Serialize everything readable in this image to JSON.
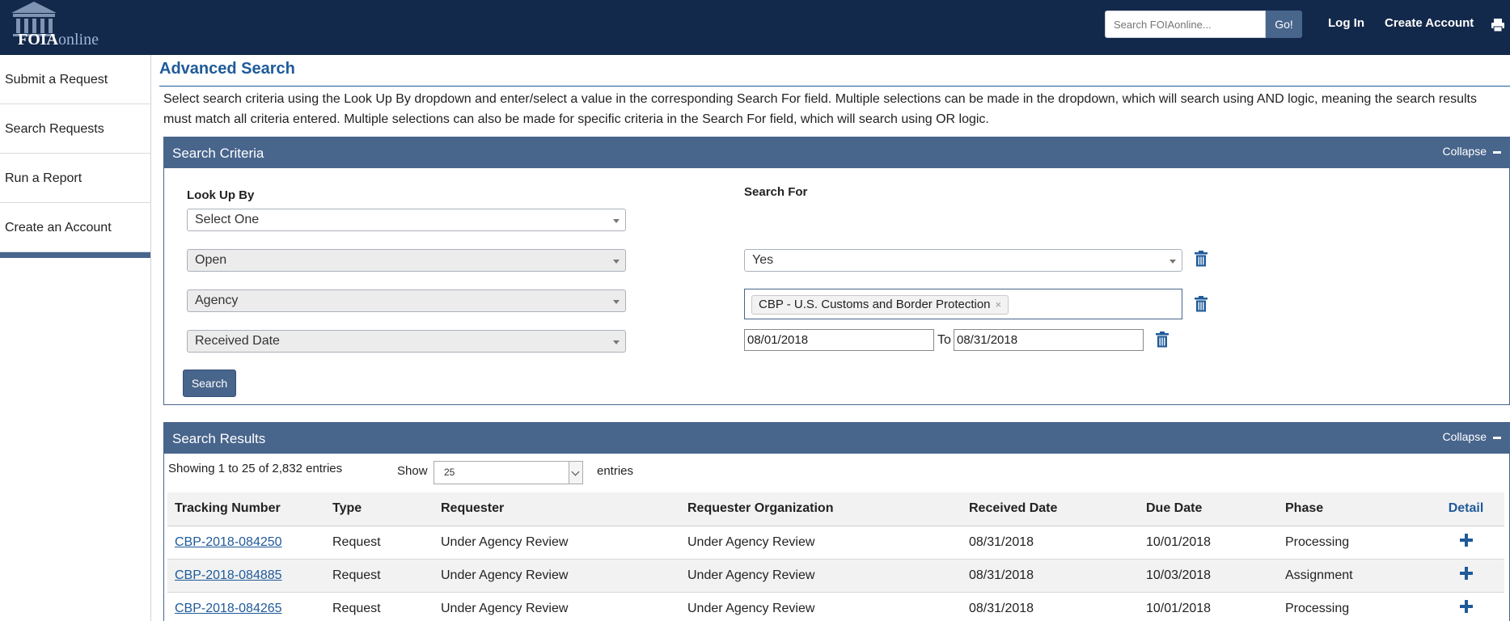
{
  "header": {
    "logo_bold": "FOIA",
    "logo_light": "online",
    "search_placeholder": "Search FOIAonline...",
    "go_label": "Go!",
    "login_label": "Log In",
    "create_account_label": "Create Account"
  },
  "sidebar": {
    "items": [
      {
        "label": "Submit a Request"
      },
      {
        "label": "Search Requests"
      },
      {
        "label": "Run a Report"
      },
      {
        "label": "Create an Account"
      }
    ]
  },
  "page": {
    "title": "Advanced Search",
    "intro": "Select search criteria using the Look Up By dropdown and enter/select a value in the corresponding Search For field. Multiple selections can be made in the dropdown, which will search using AND logic, meaning the search results must match all criteria entered. Multiple selections can also be made for specific criteria in the Search For field, which will search using OR logic."
  },
  "criteria": {
    "title": "Search Criteria",
    "collapse_label": "Collapse",
    "lookup_label": "Look Up By",
    "searchfor_label": "Search For",
    "select_one": "Select One",
    "rows": [
      {
        "lookup": "Open",
        "value": "Yes"
      },
      {
        "lookup": "Agency",
        "tag": "CBP - U.S. Customs and Border Protection",
        "tag_remove": "×"
      },
      {
        "lookup": "Received Date",
        "date_from": "08/01/2018",
        "to_label": "To",
        "date_to": "08/31/2018"
      }
    ],
    "search_button": "Search"
  },
  "results": {
    "title": "Search Results",
    "collapse_label": "Collapse",
    "showing": "Showing 1 to 25 of 2,832 entries",
    "show_label": "Show",
    "page_size": "25",
    "entries_label": "entries",
    "columns": [
      "Tracking Number",
      "Type",
      "Requester",
      "Requester Organization",
      "Received Date",
      "Due Date",
      "Phase",
      "Detail"
    ],
    "rows": [
      {
        "tracking": "CBP-2018-084250",
        "type": "Request",
        "requester": "Under Agency Review",
        "org": "Under Agency Review",
        "received": "08/31/2018",
        "due": "10/01/2018",
        "phase": "Processing"
      },
      {
        "tracking": "CBP-2018-084885",
        "type": "Request",
        "requester": "Under Agency Review",
        "org": "Under Agency Review",
        "received": "08/31/2018",
        "due": "10/03/2018",
        "phase": "Assignment"
      },
      {
        "tracking": "CBP-2018-084265",
        "type": "Request",
        "requester": "Under Agency Review",
        "org": "Under Agency Review",
        "received": "08/31/2018",
        "due": "10/01/2018",
        "phase": "Processing"
      }
    ]
  },
  "icons": {
    "logo": "building-columns-icon",
    "print": "printer-icon",
    "trash": "trash-icon",
    "detail": "plus-icon"
  },
  "colors": {
    "header_bg": "#13294b",
    "panel_bg": "#48658c",
    "link": "#1f5a9a"
  }
}
